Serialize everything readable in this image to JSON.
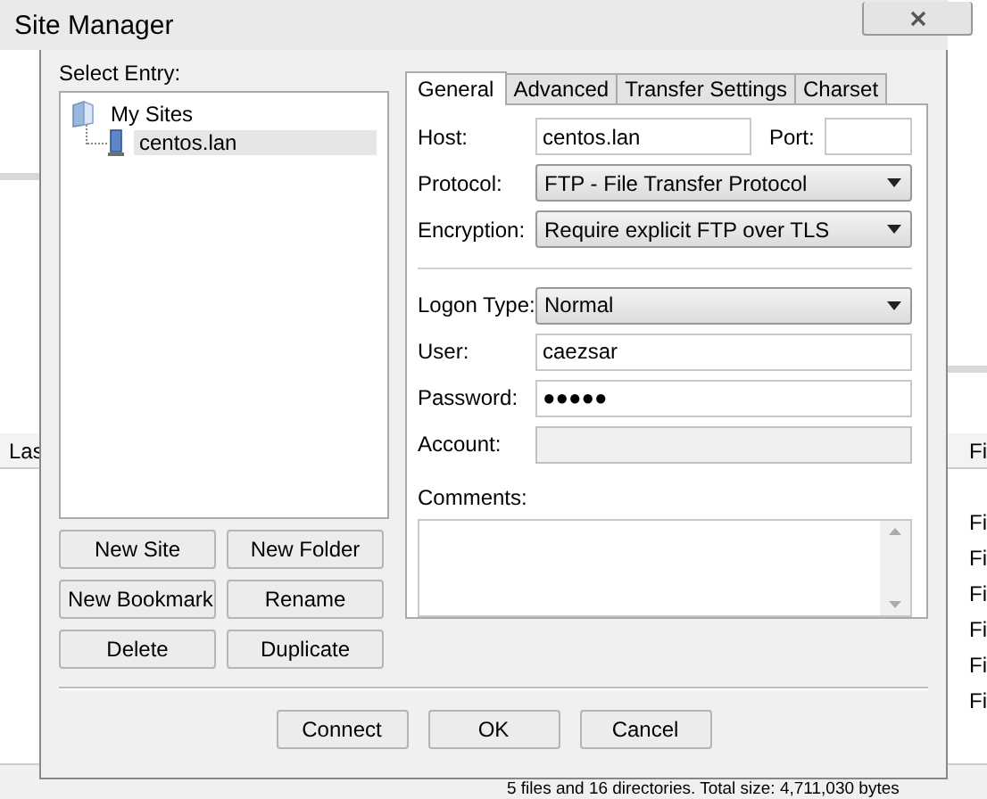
{
  "background_window": {
    "left_column_header": "Las",
    "right_column_header": "Fi",
    "right_rows": [
      "Fi",
      "Fi",
      "Fi",
      "Fi",
      "Fi",
      "Fi"
    ],
    "status_bar": "5 files and 16 directories. Total size: 4,711,030 bytes"
  },
  "window": {
    "title": "Site Manager"
  },
  "select_entry_label": "Select Entry:",
  "tree": [
    {
      "label": "My Sites",
      "kind": "folder",
      "expanded": true,
      "selected": false,
      "children": [
        {
          "label": "centos.lan",
          "kind": "site",
          "selected": true
        }
      ]
    }
  ],
  "entry_buttons": [
    "New Site",
    "New Folder",
    "New Bookmark",
    "Rename",
    "Delete",
    "Duplicate"
  ],
  "tabs": [
    {
      "label": "General",
      "selected": true
    },
    {
      "label": "Advanced",
      "selected": false
    },
    {
      "label": "Transfer Settings",
      "selected": false
    },
    {
      "label": "Charset",
      "selected": false
    }
  ],
  "host": {
    "label": "Host:",
    "value": "centos.lan"
  },
  "port": {
    "label": "Port:"
  },
  "protocol": {
    "label": "Protocol:",
    "value": "FTP - File Transfer Protocol"
  },
  "encryption": {
    "label": "Encryption:",
    "value": "Require explicit FTP over TLS"
  },
  "logon_type": {
    "label": "Logon Type:",
    "value": "Normal"
  },
  "user": {
    "label": "User:",
    "value": "caezsar"
  },
  "password": {
    "label": "Password:",
    "value": "●●●●●"
  },
  "account": {
    "label": "Account:",
    "disabled": true
  },
  "comments": {
    "label": "Comments:"
  },
  "buttons": [
    "Connect",
    "OK",
    "Cancel"
  ]
}
